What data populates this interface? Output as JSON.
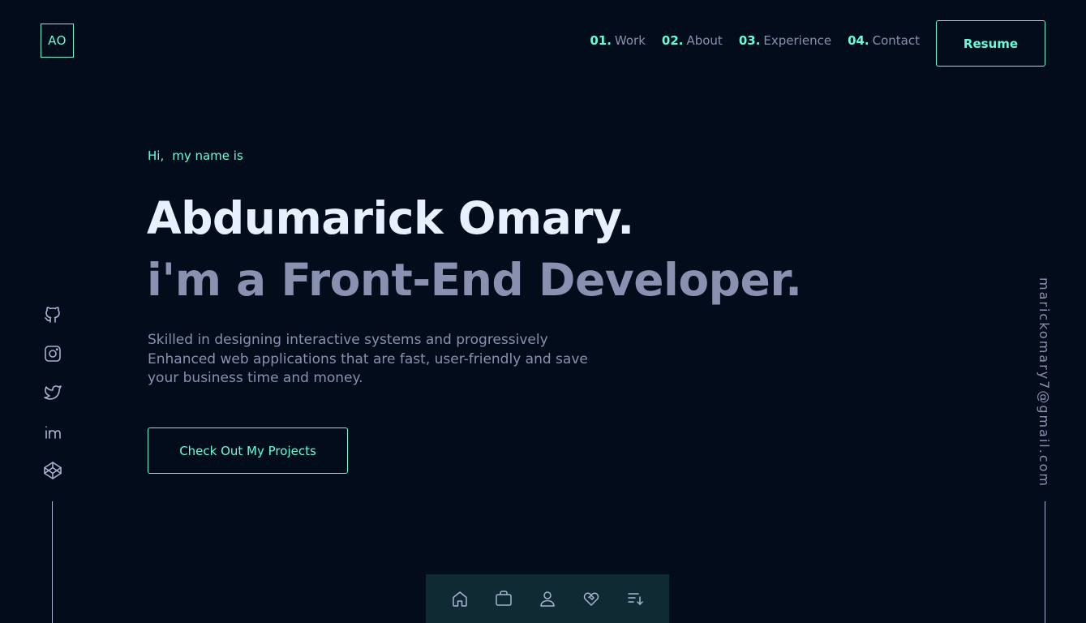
{
  "brand": {
    "logo_text": "AO"
  },
  "nav": {
    "items": [
      {
        "num": "01.",
        "label": "Work"
      },
      {
        "num": "02.",
        "label": "About"
      },
      {
        "num": "03.",
        "label": "Experience"
      },
      {
        "num": "04.",
        "label": "Contact"
      }
    ],
    "resume_label": "Resume"
  },
  "hero": {
    "greeting_hi": "Hi,",
    "greeting_rest": "my name is",
    "name": "Abdumarick Omary.",
    "role": "i'm a Front-End Developer.",
    "description": "Skilled in designing interactive systems and progressively Enhanced web applications that are fast, user-friendly and save your business time and money.",
    "cta_label": "Check Out My Projects"
  },
  "social": {
    "items": [
      {
        "icon": "github-icon"
      },
      {
        "icon": "instagram-icon"
      },
      {
        "icon": "twitter-icon"
      },
      {
        "icon": "linkedin-icon"
      },
      {
        "icon": "codepen-icon"
      }
    ]
  },
  "email": "marickomary7@gmail.com",
  "dock": {
    "items": [
      {
        "icon": "home-icon"
      },
      {
        "icon": "briefcase-icon"
      },
      {
        "icon": "user-icon"
      },
      {
        "icon": "handshake-icon"
      },
      {
        "icon": "sort-list-icon"
      }
    ]
  },
  "colors": {
    "background": "#020c1b",
    "accent": "#64ffda",
    "heading": "#e6f1ff",
    "muted": "#8892b0",
    "dock_background": "#0f2a33"
  }
}
